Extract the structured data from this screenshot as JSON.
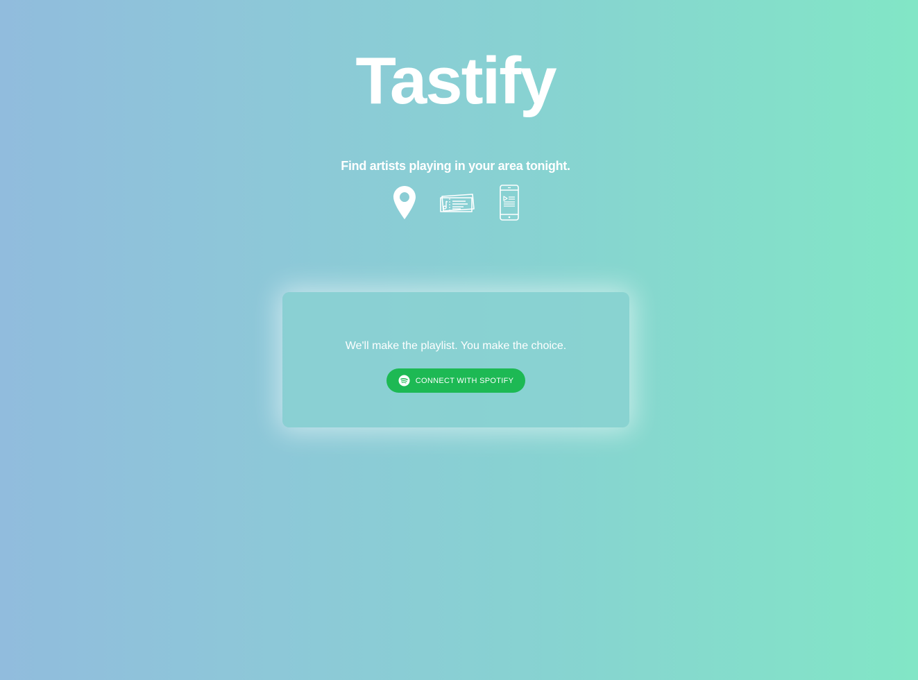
{
  "header": {
    "app_title": "Tastify",
    "tagline": "Find artists playing in your area tonight."
  },
  "icons": [
    "location-pin-icon",
    "concert-ticket-icon",
    "phone-playlist-icon"
  ],
  "card": {
    "text": "We'll make the playlist. You make the choice.",
    "connect_button_label": "CONNECT WITH SPOTIFY",
    "button_icon": "spotify-icon"
  },
  "colors": {
    "gradient_start": "#91bcdd",
    "gradient_end": "#82e6c6",
    "spotify_green": "#1db954",
    "text": "#ffffff"
  }
}
